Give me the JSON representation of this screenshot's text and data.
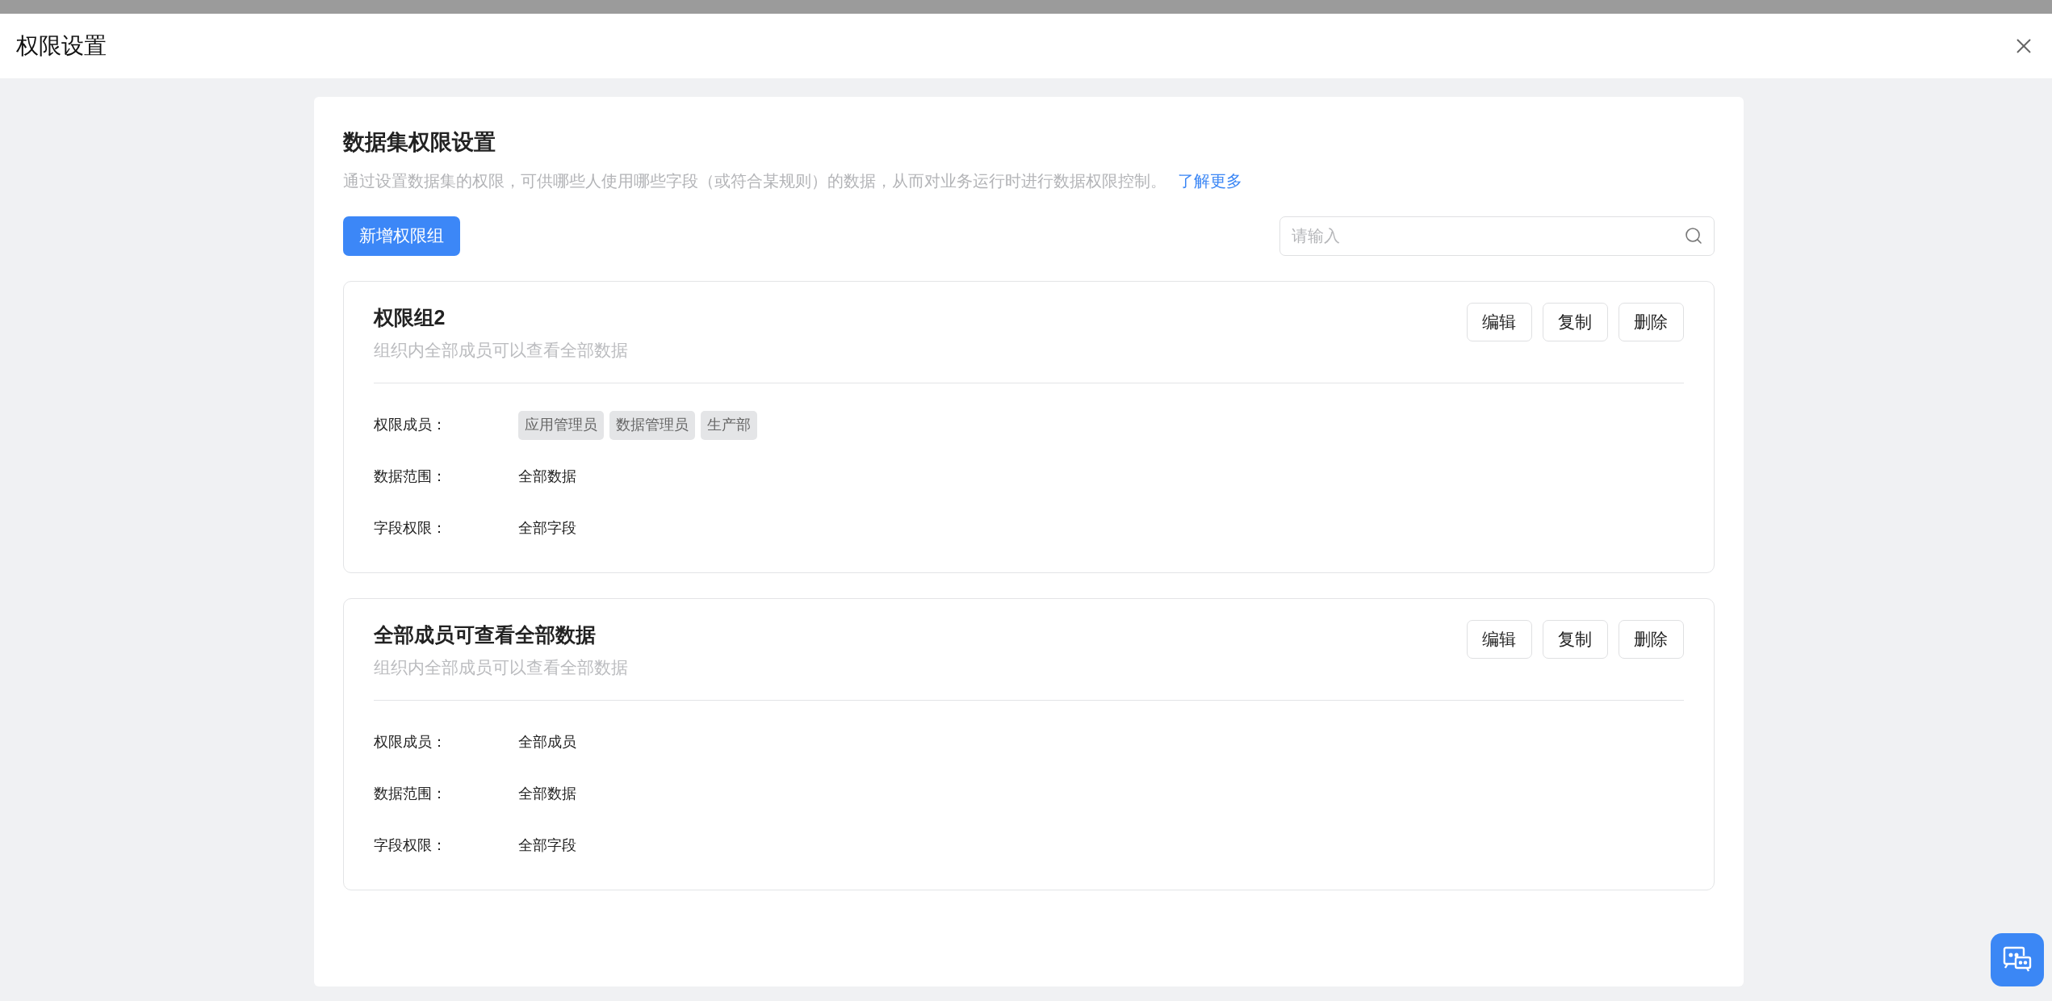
{
  "dialog": {
    "title": "权限设置"
  },
  "panel": {
    "title": "数据集权限设置",
    "description": "通过设置数据集的权限，可供哪些人使用哪些字段（或符合某规则）的数据，从而对业务运行时进行数据权限控制。",
    "learn_more": "了解更多",
    "add_button": "新增权限组",
    "search": {
      "placeholder": "请输入"
    },
    "groups": [
      {
        "name": "权限组2",
        "description": "组织内全部成员可以查看全部数据",
        "actions": [
          "编辑",
          "复制",
          "删除"
        ],
        "fields": [
          {
            "label": "权限成员：",
            "kind": "tags",
            "tags": [
              "应用管理员",
              "数据管理员",
              "生产部"
            ]
          },
          {
            "label": "数据范围：",
            "kind": "text",
            "value": "全部数据"
          },
          {
            "label": "字段权限：",
            "kind": "text",
            "value": "全部字段"
          }
        ]
      },
      {
        "name": "全部成员可查看全部数据",
        "description": "组织内全部成员可以查看全部数据",
        "actions": [
          "编辑",
          "复制",
          "删除"
        ],
        "fields": [
          {
            "label": "权限成员：",
            "kind": "text",
            "value": "全部成员"
          },
          {
            "label": "数据范围：",
            "kind": "text",
            "value": "全部数据"
          },
          {
            "label": "字段权限：",
            "kind": "text",
            "value": "全部字段"
          }
        ]
      }
    ]
  }
}
